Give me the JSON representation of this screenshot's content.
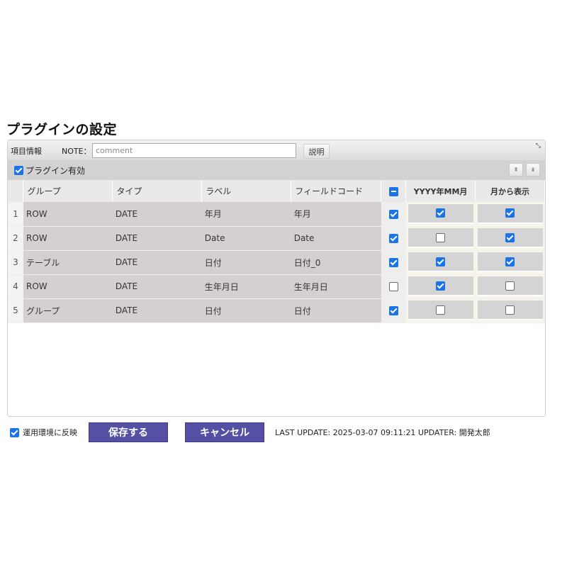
{
  "page": {
    "title": "プラグインの設定"
  },
  "toolbar": {
    "item_info_label": "項目情報",
    "note_label": "NOTE：",
    "note_value": "",
    "note_placeholder": "comment",
    "help_label": "説明",
    "expand_icon": "expand-icon"
  },
  "subbar": {
    "enable_label": "プラグイン有効",
    "enable_checked": true,
    "move_up_label": "⇞",
    "move_down_label": "⇟"
  },
  "table": {
    "columns": [
      "グループ",
      "タイプ",
      "ラベル",
      "フィールドコード",
      "",
      "YYYY年MM月",
      "月から表示"
    ],
    "rows": [
      {
        "num": "1",
        "group": "ROW",
        "type": "DATE",
        "label": "年月",
        "code": "年月",
        "enabled": true,
        "yyyymm": true,
        "from_month": true
      },
      {
        "num": "2",
        "group": "ROW",
        "type": "DATE",
        "label": "Date",
        "code": "Date",
        "enabled": true,
        "yyyymm": false,
        "from_month": true
      },
      {
        "num": "3",
        "group": "テーブル",
        "type": "DATE",
        "label": "日付",
        "code": "日付_0",
        "enabled": true,
        "yyyymm": true,
        "from_month": true
      },
      {
        "num": "4",
        "group": "ROW",
        "type": "DATE",
        "label": "生年月日",
        "code": "生年月日",
        "enabled": false,
        "yyyymm": true,
        "from_month": false
      },
      {
        "num": "5",
        "group": "グループ",
        "type": "DATE",
        "label": "日付",
        "code": "日付",
        "enabled": true,
        "yyyymm": false,
        "from_month": false
      }
    ]
  },
  "footer": {
    "deploy_label": "運用環境に反映",
    "deploy_checked": true,
    "save_label": "保存する",
    "cancel_label": "キャンセル",
    "status": "LAST UPDATE: 2025-03-07 09:11:21 UPDATER: 開発太郎"
  },
  "colors": {
    "accent": "#1a73e8",
    "button": "#5550a4",
    "cell_bg": "#d6cfcf"
  }
}
